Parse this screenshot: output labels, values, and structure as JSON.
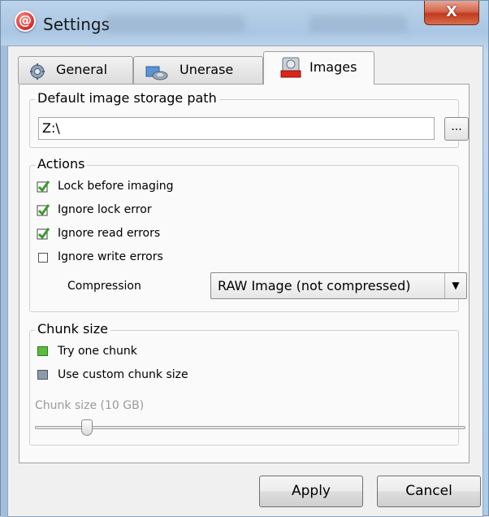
{
  "window": {
    "title": "Settings",
    "close_label": "X"
  },
  "tabs": [
    {
      "label": "General",
      "icon": "gear-icon",
      "active": false
    },
    {
      "label": "Unerase",
      "icon": "unerase-icon",
      "active": false
    },
    {
      "label": "Images",
      "icon": "disk-image-icon",
      "active": true
    }
  ],
  "storage": {
    "group_title": "Default image storage path",
    "path_value": "Z:\\",
    "browse_label": "..."
  },
  "actions": {
    "group_title": "Actions",
    "options": [
      {
        "label": "Lock before imaging",
        "checked": true
      },
      {
        "label": "Ignore lock error",
        "checked": true
      },
      {
        "label": "Ignore read errors",
        "checked": true
      },
      {
        "label": "Ignore write errors",
        "checked": false
      }
    ],
    "compression_label": "Compression",
    "compression_value": "RAW Image (not compressed)"
  },
  "chunk": {
    "group_title": "Chunk size",
    "options": [
      {
        "label": "Try one chunk",
        "selected": true
      },
      {
        "label": "Use custom chunk size",
        "selected": false
      }
    ],
    "size_label": "Chunk size (10 GB)",
    "slider_fraction": 0.11
  },
  "buttons": {
    "apply": "Apply",
    "cancel": "Cancel"
  },
  "colors": {
    "check_green": "#5cbb3d",
    "close_red": "#c13a1e",
    "title_bar_blue": "#aecbe6"
  }
}
